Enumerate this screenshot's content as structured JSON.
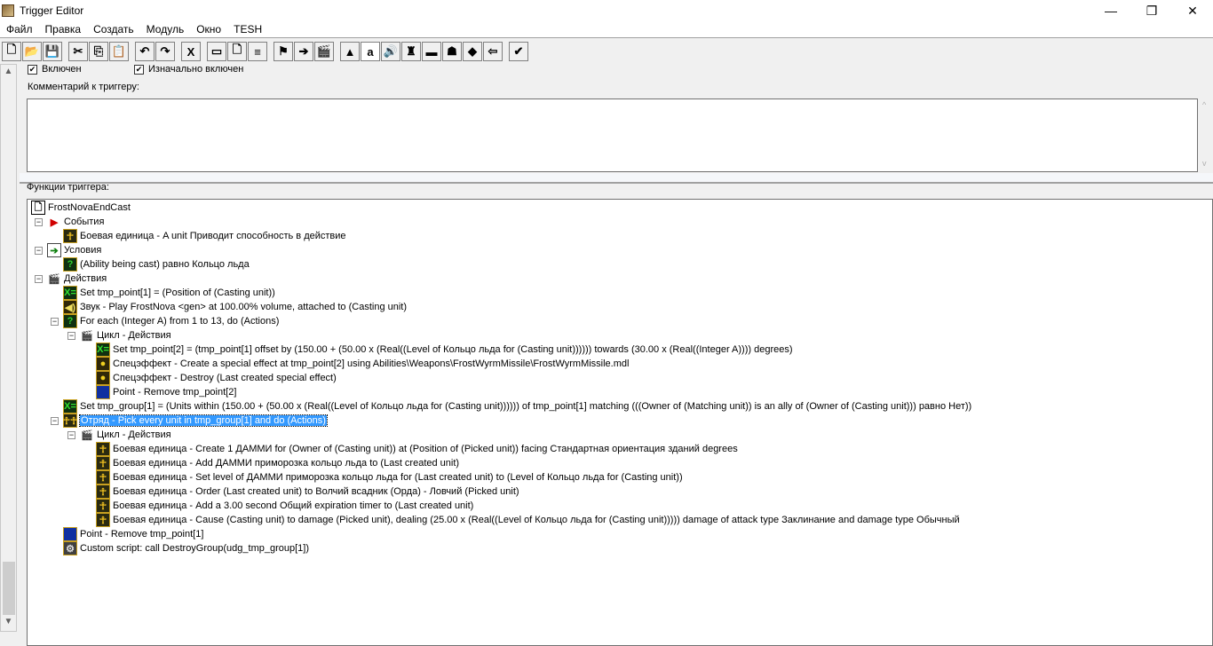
{
  "window": {
    "title": "Trigger Editor",
    "minimize": "—",
    "maximize": "❐",
    "close": "✕"
  },
  "menu": [
    "Файл",
    "Правка",
    "Создать",
    "Модуль",
    "Окно",
    "TESH"
  ],
  "toolbar": [
    {
      "name": "new-icon",
      "g": "🗋"
    },
    {
      "name": "open-icon",
      "g": "📂"
    },
    {
      "name": "save-icon",
      "g": "💾"
    },
    {
      "sep": true
    },
    {
      "name": "cut-icon",
      "g": "✂"
    },
    {
      "name": "copy-icon",
      "g": "⎘"
    },
    {
      "name": "paste-icon",
      "g": "📋"
    },
    {
      "sep": true
    },
    {
      "name": "undo-icon",
      "g": "↶"
    },
    {
      "name": "redo-icon",
      "g": "↷"
    },
    {
      "sep": true
    },
    {
      "name": "variables-icon",
      "g": "X"
    },
    {
      "sep": true
    },
    {
      "name": "new-category-icon",
      "g": "▭"
    },
    {
      "name": "new-trigger-icon",
      "g": "🗋"
    },
    {
      "name": "new-comment-icon",
      "g": "≡"
    },
    {
      "sep": true
    },
    {
      "name": "new-event-icon",
      "g": "⚑"
    },
    {
      "name": "new-condition-icon",
      "g": "➔"
    },
    {
      "name": "new-action-icon",
      "g": "🎬"
    },
    {
      "sep": true
    },
    {
      "name": "terrain-editor-icon",
      "g": "▲"
    },
    {
      "name": "trigger-editor-icon",
      "g": "a",
      "on": true
    },
    {
      "name": "sound-editor-icon",
      "g": "🔊"
    },
    {
      "name": "object-editor-icon",
      "g": "♜"
    },
    {
      "name": "campaign-editor-icon",
      "g": "▬"
    },
    {
      "name": "ai-editor-icon",
      "g": "☗"
    },
    {
      "name": "object-manager-icon",
      "g": "◆"
    },
    {
      "name": "import-manager-icon",
      "g": "⇦"
    },
    {
      "sep": true
    },
    {
      "name": "test-map-icon",
      "g": "✔"
    }
  ],
  "checkboxes": {
    "enabled": "Включен",
    "initially_on": "Изначально включен",
    "check": "✔"
  },
  "comment_label": "Комментарий к триггеру:",
  "functions_label": "Функции триггера:",
  "tree": [
    {
      "lv": 0,
      "icon": "doc",
      "g": "🗋",
      "text": "FrostNovaEndCast"
    },
    {
      "lv": 1,
      "icon": "flag",
      "g": "▶",
      "text": "События",
      "exp": true
    },
    {
      "lv": 2,
      "icon": "unit",
      "g": "☥",
      "text": "Боевая единица - A unit Приводит способность в действие"
    },
    {
      "lv": 1,
      "icon": "cond",
      "g": "➔",
      "text": "Условия",
      "exp": true
    },
    {
      "lv": 2,
      "icon": "q",
      "g": "?",
      "text": "(Ability being cast) равно Кольцо льда"
    },
    {
      "lv": 1,
      "icon": "act",
      "g": "🎬",
      "text": "Действия",
      "exp": true
    },
    {
      "lv": 2,
      "icon": "set",
      "g": "X=",
      "text": "Set tmp_point[1] = (Position of (Casting unit))"
    },
    {
      "lv": 2,
      "icon": "snd",
      "g": "◀)",
      "text": "Звук - Play FrostNova <gen> at 100.00% volume, attached to (Casting unit)"
    },
    {
      "lv": 2,
      "icon": "q",
      "g": "?",
      "text": "For each (Integer A) from 1 to 13, do (Actions)",
      "exp": true
    },
    {
      "lv": 3,
      "icon": "act",
      "g": "🎬",
      "text": "Цикл - Действия",
      "exp": true
    },
    {
      "lv": 4,
      "icon": "set",
      "g": "X=",
      "text": "Set tmp_point[2] = (tmp_point[1] offset by (150.00 + (50.00 x (Real((Level of Кольцо льда  for (Casting unit)))))) towards (30.00 x (Real((Integer A)))) degrees)"
    },
    {
      "lv": 4,
      "icon": "fx",
      "g": "●",
      "text": "Спецэффект - Create a special effect at tmp_point[2] using Abilities\\Weapons\\FrostWyrmMissile\\FrostWyrmMissile.mdl"
    },
    {
      "lv": 4,
      "icon": "fx",
      "g": "●",
      "text": "Спецэффект - Destroy (Last created special effect)"
    },
    {
      "lv": 4,
      "icon": "pt",
      "g": "■",
      "text": "Point - Remove tmp_point[2]"
    },
    {
      "lv": 2,
      "icon": "set",
      "g": "X=",
      "text": "Set tmp_group[1] = (Units within (150.00 + (50.00 x (Real((Level of Кольцо льда  for (Casting unit)))))) of tmp_point[1] matching (((Owner of (Matching unit)) is an ally of (Owner of (Casting unit))) равно Нет))"
    },
    {
      "lv": 2,
      "icon": "unit",
      "g": "☥☥",
      "text": "Отряд - Pick every unit in tmp_group[1] and do (Actions)",
      "exp": true,
      "sel": true
    },
    {
      "lv": 3,
      "icon": "act",
      "g": "🎬",
      "text": "Цикл - Действия",
      "exp": true
    },
    {
      "lv": 4,
      "icon": "unit",
      "g": "☥",
      "text": "Боевая единица - Create 1 ДАММИ for (Owner of (Casting unit)) at (Position of (Picked unit)) facing Стандартная ориентация зданий degrees"
    },
    {
      "lv": 4,
      "icon": "unit",
      "g": "☥",
      "text": "Боевая единица - Add ДАММИ приморозка кольцо льда  to (Last created unit)"
    },
    {
      "lv": 4,
      "icon": "unit",
      "g": "☥",
      "text": "Боевая единица - Set level of ДАММИ приморозка кольцо льда  for (Last created unit) to (Level of Кольцо льда  for (Casting unit))"
    },
    {
      "lv": 4,
      "icon": "unit",
      "g": "☥",
      "text": "Боевая единица - Order (Last created unit) to Волчий всадник (Орда) - Ловчий (Picked unit)"
    },
    {
      "lv": 4,
      "icon": "unit",
      "g": "☥",
      "text": "Боевая единица - Add a 3.00 second Общий expiration timer to (Last created unit)"
    },
    {
      "lv": 4,
      "icon": "unit",
      "g": "☥",
      "text": "Боевая единица - Cause (Casting unit) to damage (Picked unit), dealing (25.00 x (Real((Level of Кольцо льда  for (Casting unit))))) damage of attack type Заклинание and damage type Обычный"
    },
    {
      "lv": 2,
      "icon": "pt",
      "g": "■",
      "text": "Point - Remove tmp_point[1]"
    },
    {
      "lv": 2,
      "icon": "scr",
      "g": "⚙",
      "text": "Custom script:   call DestroyGroup(udg_tmp_group[1])"
    }
  ],
  "scroll": {
    "up": "▲",
    "down": "▼",
    "up_small": "^",
    "down_small": "v"
  }
}
